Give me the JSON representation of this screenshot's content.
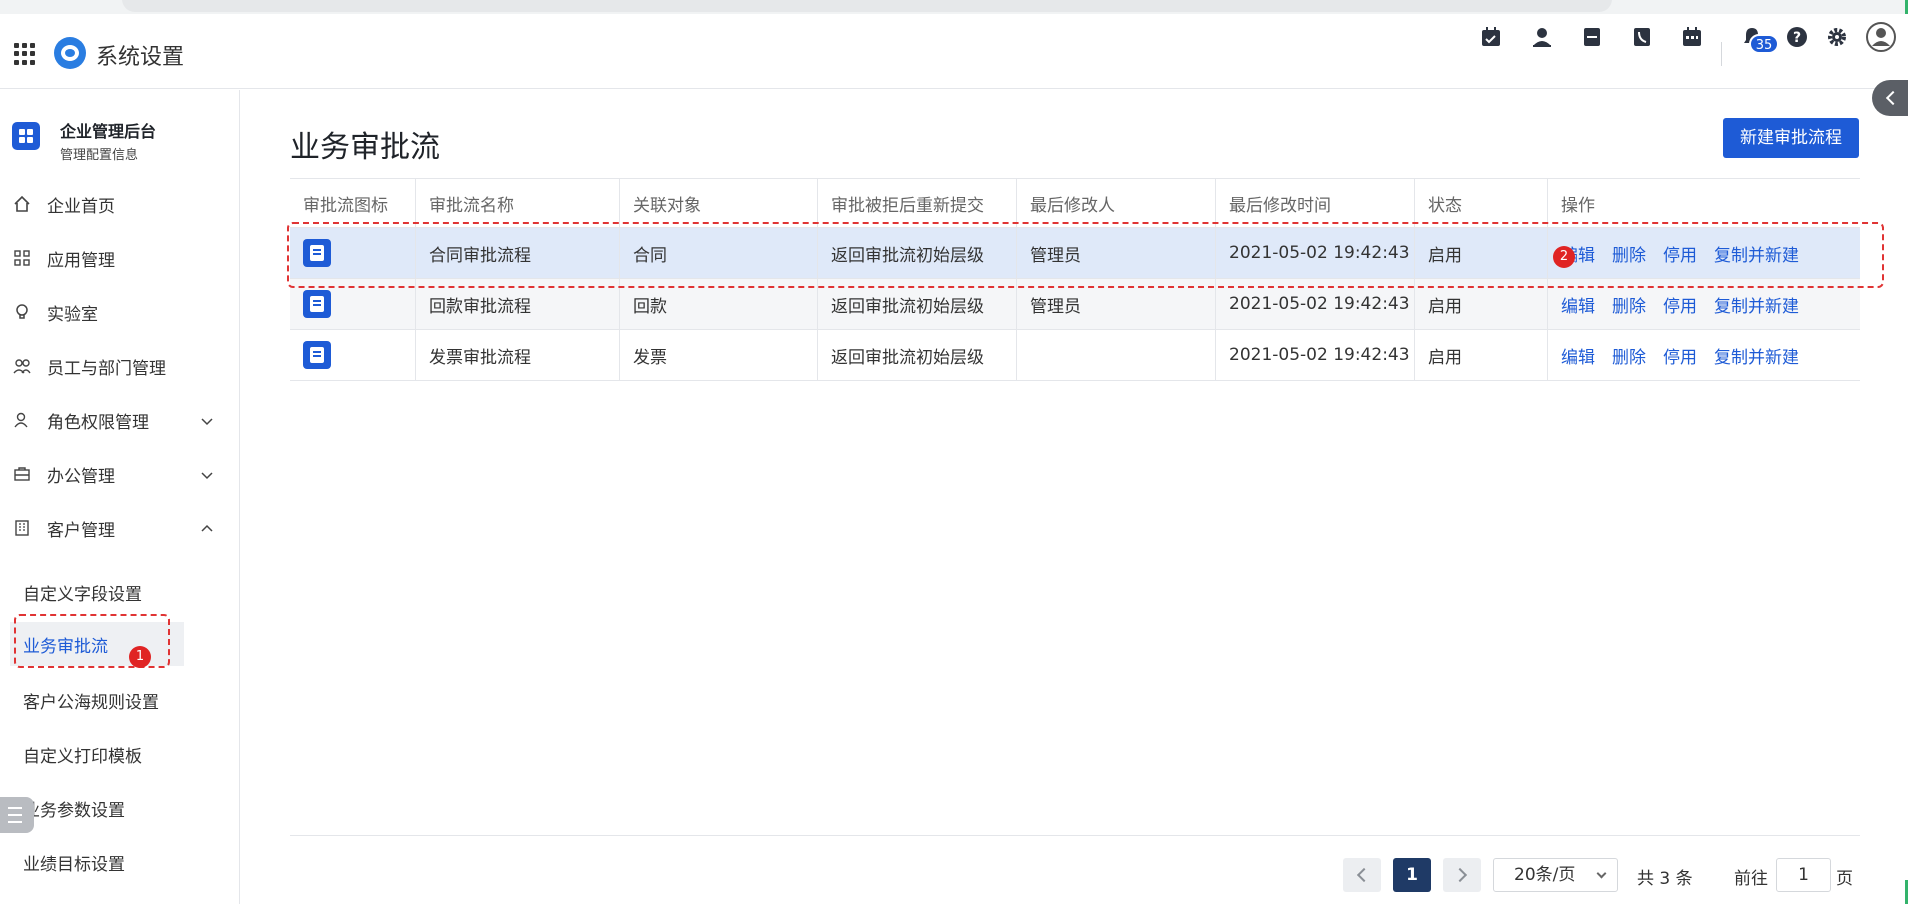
{
  "header": {
    "app_title": "系统设置",
    "notification_count": "35",
    "icons": [
      "calendar-check-icon",
      "contact-icon",
      "document-icon",
      "phone-icon",
      "calendar-icon",
      "bell-icon",
      "help-icon",
      "gear-icon",
      "user-avatar-icon"
    ]
  },
  "sidebar": {
    "brand_title": "企业管理后台",
    "brand_subtitle": "管理配置信息",
    "items": [
      {
        "label": "企业首页",
        "icon": "home-icon"
      },
      {
        "label": "应用管理",
        "icon": "grid-icon"
      },
      {
        "label": "实验室",
        "icon": "bulb-icon"
      },
      {
        "label": "员工与部门管理",
        "icon": "users-icon"
      },
      {
        "label": "角色权限管理",
        "icon": "role-icon",
        "expandable": true
      },
      {
        "label": "办公管理",
        "icon": "briefcase-icon",
        "expandable": true
      },
      {
        "label": "客户管理",
        "icon": "building-icon",
        "expanded": true
      }
    ],
    "sub_items": [
      {
        "label": "自定义字段设置"
      },
      {
        "label": "业务审批流",
        "active": true
      },
      {
        "label": "客户公海规则设置"
      },
      {
        "label": "自定义打印模板"
      },
      {
        "label": "业务参数设置"
      },
      {
        "label": "业绩目标设置"
      }
    ]
  },
  "annotations": {
    "one": "1",
    "two": "2"
  },
  "main": {
    "title": "业务审批流",
    "new_button": "新建审批流程",
    "columns": [
      "审批流图标",
      "审批流名称",
      "关联对象",
      "审批被拒后重新提交",
      "最后修改人",
      "最后修改时间",
      "状态",
      "操作"
    ],
    "rows": [
      {
        "icon": "contract-icon",
        "name": "合同审批流程",
        "object": "合同",
        "resubmit": "返回审批流初始层级",
        "modifier": "管理员",
        "time": "2021-05-02 19:42:43",
        "status": "启用"
      },
      {
        "icon": "payment-icon",
        "name": "回款审批流程",
        "object": "回款",
        "resubmit": "返回审批流初始层级",
        "modifier": "管理员",
        "time": "2021-05-02 19:42:43",
        "status": "启用"
      },
      {
        "icon": "invoice-icon",
        "name": "发票审批流程",
        "object": "发票",
        "resubmit": "返回审批流初始层级",
        "modifier": "",
        "time": "2021-05-02 19:42:43",
        "status": "启用"
      }
    ],
    "ops": {
      "edit": "编辑",
      "delete": "删除",
      "disable": "停用",
      "copy": "复制并新建"
    }
  },
  "pagination": {
    "current": "1",
    "page_size": "20条/页",
    "total": "共 3 条",
    "goto_label": "前往",
    "goto_value": "1",
    "page_suffix": "页"
  },
  "colors": {
    "accent": "#1e5bd6",
    "annotation": "#e03434"
  }
}
